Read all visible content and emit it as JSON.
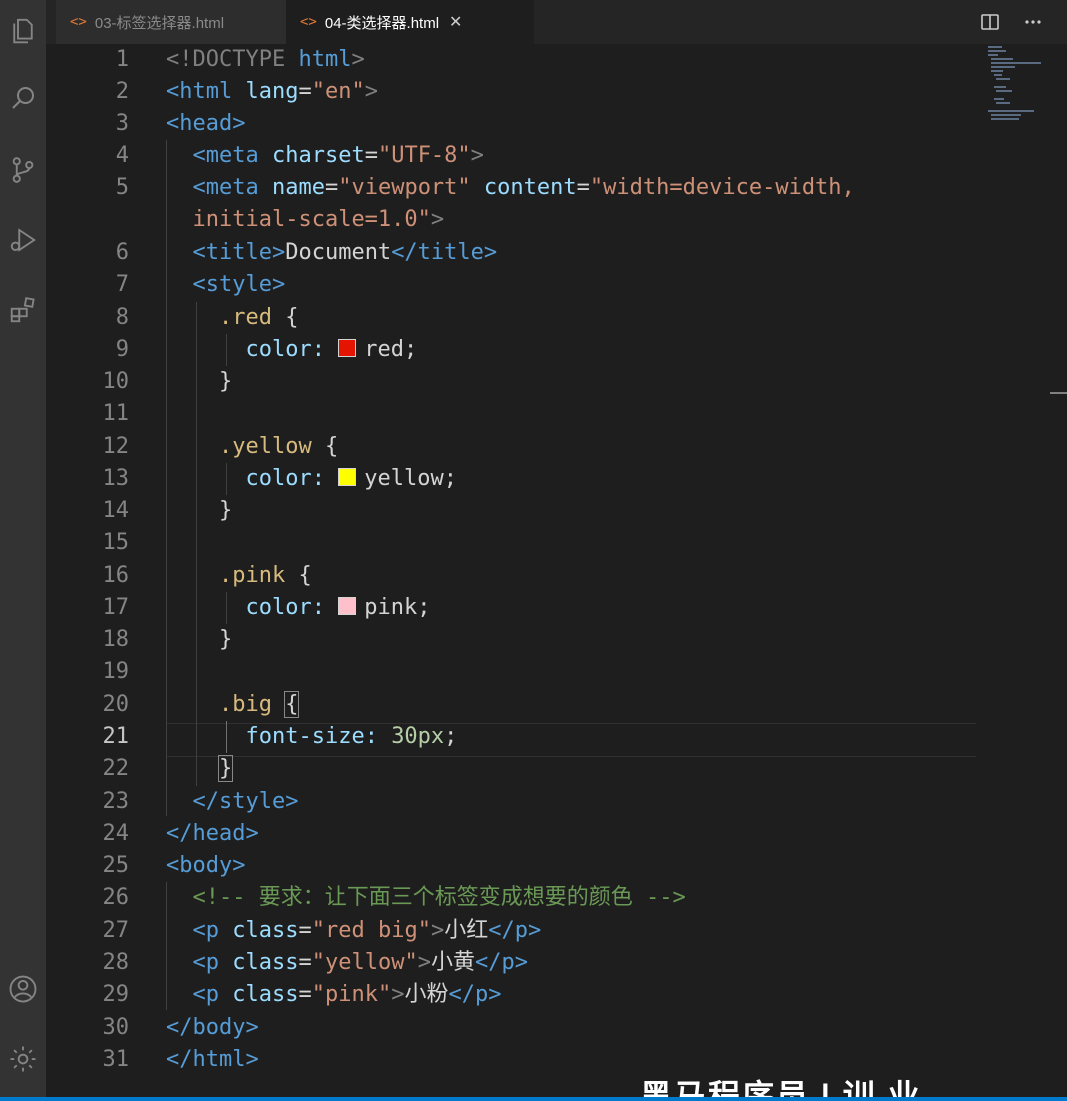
{
  "tabs": [
    {
      "label": "03-标签选择器.html",
      "icon": "code-file-icon",
      "active": false
    },
    {
      "label": "04-类选择器.html",
      "icon": "code-file-icon",
      "active": true
    }
  ],
  "tab_close_glyph": "✕",
  "code_lines": [
    {
      "n": "1"
    },
    {
      "n": "2"
    },
    {
      "n": "3"
    },
    {
      "n": "4"
    },
    {
      "n": "5"
    },
    {
      "n": ""
    },
    {
      "n": "6"
    },
    {
      "n": "7"
    },
    {
      "n": "8"
    },
    {
      "n": "9"
    },
    {
      "n": "10"
    },
    {
      "n": "11"
    },
    {
      "n": "12"
    },
    {
      "n": "13"
    },
    {
      "n": "14"
    },
    {
      "n": "15"
    },
    {
      "n": "16"
    },
    {
      "n": "17"
    },
    {
      "n": "18"
    },
    {
      "n": "19"
    },
    {
      "n": "20"
    },
    {
      "n": "21"
    },
    {
      "n": "22"
    },
    {
      "n": "23"
    },
    {
      "n": "24"
    },
    {
      "n": "25"
    },
    {
      "n": "26"
    },
    {
      "n": "27"
    },
    {
      "n": "28"
    },
    {
      "n": "29"
    },
    {
      "n": "30"
    },
    {
      "n": "31"
    }
  ],
  "active_line": "21",
  "code": {
    "l1_doctype": "<!DOCTYPE",
    "l1_html": "html",
    "l1_end": ">",
    "l2_tag": "<html",
    "l2_attr": "lang",
    "l2_eq": "=",
    "l2_val": "\"en\"",
    "l2_end": ">",
    "l3": "<head>",
    "l4_tag": "<meta",
    "l4_attr": "charset",
    "l4_eq": "=",
    "l4_val": "\"UTF-8\"",
    "l4_end": ">",
    "l5_tag": "<meta",
    "l5_attr1": "name",
    "l5_eq1": "=",
    "l5_val1": "\"viewport\"",
    "l5_attr2": "content",
    "l5_eq2": "=",
    "l5_val2": "\"width=device-width,",
    "l5b_val": "initial-scale=1.0\"",
    "l5b_end": ">",
    "l6_open": "<title>",
    "l6_text": "Document",
    "l6_close": "</title>",
    "l7": "<style>",
    "l8_sel": ".red",
    "l8_brace": " {",
    "l9_prop": "color:",
    "l9_val": "red;",
    "l10": "}",
    "l12_sel": ".yellow",
    "l12_brace": " {",
    "l13_prop": "color:",
    "l13_val": "yellow;",
    "l14": "}",
    "l16_sel": ".pink",
    "l16_brace": " {",
    "l17_prop": "color:",
    "l17_val": "pink;",
    "l18": "}",
    "l20_sel": ".big",
    "l20_brace": "{",
    "l21_prop": "font-size:",
    "l21_val": "30px",
    "l21_semi": ";",
    "l22": "}",
    "l23": "</style>",
    "l24": "</head>",
    "l25": "<body>",
    "l26": "<!-- 要求：让下面三个标签变成想要的颜色 -->",
    "l27_tag": "<p",
    "l27_attr": "class",
    "l27_eq": "=",
    "l27_val": "\"red big\"",
    "l27_gt": ">",
    "l27_text": "小红",
    "l27_close": "</p>",
    "l28_tag": "<p",
    "l28_attr": "class",
    "l28_eq": "=",
    "l28_val": "\"yellow\"",
    "l28_gt": ">",
    "l28_text": "小黄",
    "l28_close": "</p>",
    "l29_tag": "<p",
    "l29_attr": "class",
    "l29_eq": "=",
    "l29_val": "\"pink\"",
    "l29_gt": ">",
    "l29_text": "小粉",
    "l29_close": "</p>",
    "l30": "</body>",
    "l31": "</html>"
  },
  "swatches": {
    "red": "#e51400",
    "yellow": "#ffff00",
    "pink": "#ffc0cb"
  },
  "colors": {
    "editor_bg": "#1e1e1e",
    "activity_bg": "#333333",
    "tab_icon": "#e37933",
    "status_bar": "#007acc"
  },
  "activity_icons": [
    "explorer-icon",
    "search-icon",
    "source-control-icon",
    "run-debug-icon",
    "extensions-icon",
    "account-icon",
    "settings-gear-icon"
  ],
  "watermark": "黑马程序员 | 训 业"
}
